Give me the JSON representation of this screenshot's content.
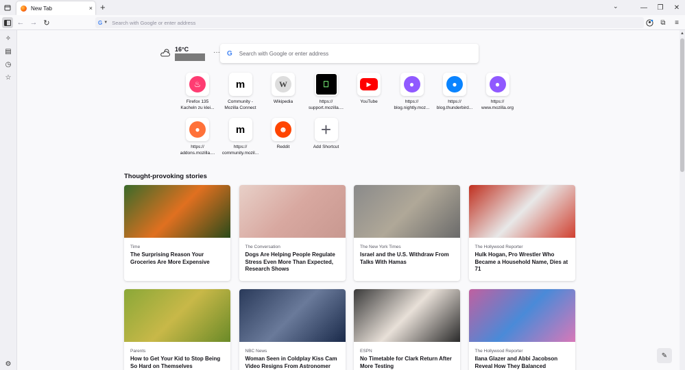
{
  "tab": {
    "title": "New Tab",
    "close": "×"
  },
  "newtab_label": "+",
  "urlbar": {
    "placeholder": "Search with Google or enter address",
    "engine": "G"
  },
  "weather": {
    "temp": "16°C",
    "more": "···"
  },
  "search": {
    "placeholder": "Search with Google or enter address",
    "engine": "G"
  },
  "shortcuts": [
    {
      "label": "Firefox 135\nKacheln zu klei...",
      "icon": "tinder-icon",
      "color": "#fe3c72"
    },
    {
      "label": "Community -\nMozilla Connect",
      "icon": "mozilla-m-icon",
      "color": "#000000"
    },
    {
      "label": "Wikipedia",
      "icon": "wikipedia-icon",
      "color": "#cccccc"
    },
    {
      "label": "https://\nsupport.mozilla....",
      "icon": "support-icon",
      "color": "#000000"
    },
    {
      "label": "YouTube",
      "icon": "youtube-icon",
      "color": "#ff0000"
    },
    {
      "label": "https://\nblog.nightly.moz...",
      "icon": "firefox-nightly-icon",
      "color": "#9059ff"
    },
    {
      "label": "https://\nblog.thunderbird...",
      "icon": "thunderbird-icon",
      "color": "#0a84ff"
    },
    {
      "label": "https://\nwww.mozilla.org",
      "icon": "firefox-icon",
      "color": "#9059ff"
    },
    {
      "label": "https://\naddons.mozilla....",
      "icon": "firefox-icon",
      "color": "#ff7139"
    },
    {
      "label": "https://\ncommunity.mozil...",
      "icon": "mozilla-m-icon",
      "color": "#000000"
    },
    {
      "label": "Reddit",
      "icon": "reddit-icon",
      "color": "#ff4500"
    },
    {
      "label": "Add Shortcut",
      "icon": "plus-icon",
      "color": "#5b5b66"
    }
  ],
  "stories_heading": "Thought-provoking stories",
  "stories": [
    {
      "source": "Time",
      "title": "The Surprising Reason Your Groceries Are More Expensive",
      "colors": [
        "#3a6a2a",
        "#e07020",
        "#2a4a1a"
      ]
    },
    {
      "source": "The Conversation",
      "title": "Dogs Are Helping People Regulate Stress Even More Than Expected, Research Shows",
      "colors": [
        "#e8d0c8",
        "#d8a8a0",
        "#c89890"
      ]
    },
    {
      "source": "The New York Times",
      "title": "Israel and the U.S. Withdraw From Talks With Hamas",
      "colors": [
        "#8a8a8a",
        "#b0a898",
        "#6a6a6a"
      ]
    },
    {
      "source": "The Hollywood Reporter",
      "title": "Hulk Hogan, Pro Wrestler Who Became a Household Name, Dies at 71",
      "colors": [
        "#c03020",
        "#e8e8e8",
        "#d04030"
      ]
    },
    {
      "source": "Parents",
      "title": "How to Get Your Kid to Stop Being So Hard on Themselves",
      "colors": [
        "#8aa838",
        "#c8b848",
        "#6a8a28"
      ]
    },
    {
      "source": "NBC News",
      "title": "Woman Seen in Coldplay Kiss Cam Video Resigns From Astronomer",
      "colors": [
        "#2a3a5a",
        "#6a7a9a",
        "#1a2a4a"
      ]
    },
    {
      "source": "ESPN",
      "title": "No Timetable for Clark Return After More Testing",
      "colors": [
        "#3a3a3a",
        "#e8e0d8",
        "#2a2a2a"
      ]
    },
    {
      "source": "The Hollywood Reporter",
      "title": "Ilana Glazer and Abbi Jacobson Reveal How They Balanced Friendship and",
      "colors": [
        "#c060a0",
        "#4a8ad8",
        "#d878b8"
      ]
    }
  ]
}
